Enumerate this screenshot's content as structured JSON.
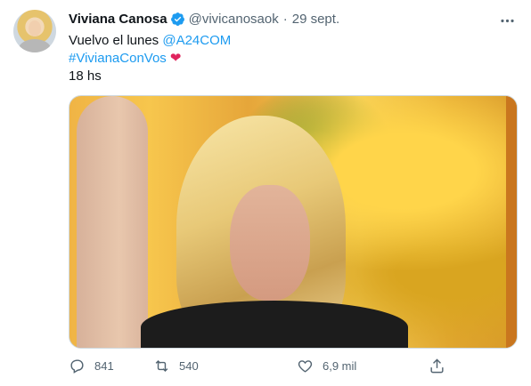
{
  "tweet": {
    "author_name": "Viviana Canosa",
    "handle": "@vivicanosaok",
    "separator": "·",
    "date": "29 sept.",
    "line1_text": "Vuelvo el lunes",
    "line1_mention": "@A24COM",
    "hashtag": "#VivianaConVos",
    "heart_emoji": "❤",
    "line3": "18 hs",
    "replies": "841",
    "retweets": "540",
    "likes": "6,9 mil"
  },
  "icons": {
    "verified": "verified-badge-icon",
    "more": "more-options-icon",
    "reply": "reply-icon",
    "retweet": "retweet-icon",
    "like": "like-heart-icon",
    "share": "share-icon"
  },
  "colors": {
    "link": "#1d9bf0",
    "verified": "#1d9bf0",
    "heart": "#e0245e",
    "muted": "#536471"
  }
}
